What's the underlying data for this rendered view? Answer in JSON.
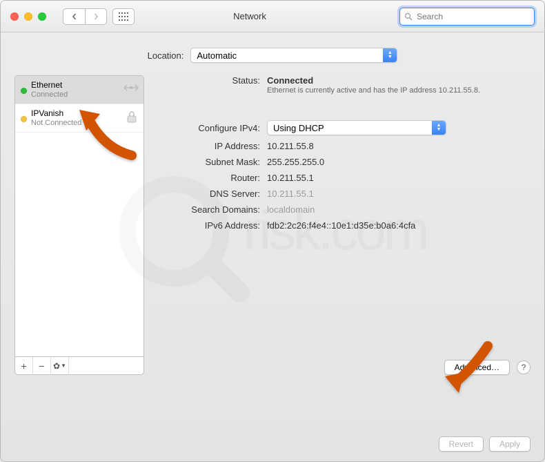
{
  "window": {
    "title": "Network"
  },
  "search": {
    "placeholder": "Search"
  },
  "location": {
    "label": "Location:",
    "value": "Automatic"
  },
  "sidebar": {
    "items": [
      {
        "name": "Ethernet",
        "status": "Connected",
        "dot": "green",
        "icon": "ethernet"
      },
      {
        "name": "IPVanish",
        "status": "Not Connected",
        "dot": "yellow",
        "icon": "lock"
      }
    ]
  },
  "details": {
    "status_label": "Status:",
    "status_value": "Connected",
    "status_desc": "Ethernet is currently active and has the IP address 10.211.55.8.",
    "configure_label": "Configure IPv4:",
    "configure_value": "Using DHCP",
    "ip_label": "IP Address:",
    "ip_value": "10.211.55.8",
    "subnet_label": "Subnet Mask:",
    "subnet_value": "255.255.255.0",
    "router_label": "Router:",
    "router_value": "10.211.55.1",
    "dns_label": "DNS Server:",
    "dns_value": "10.211.55.1",
    "search_label": "Search Domains:",
    "search_value": "localdomain",
    "ipv6_label": "IPv6 Address:",
    "ipv6_value": "fdb2:2c26:f4e4::10e1:d35e:b0a6:4cfa"
  },
  "buttons": {
    "advanced": "Advanced…",
    "revert": "Revert",
    "apply": "Apply",
    "help": "?"
  },
  "watermark": "risk.com"
}
